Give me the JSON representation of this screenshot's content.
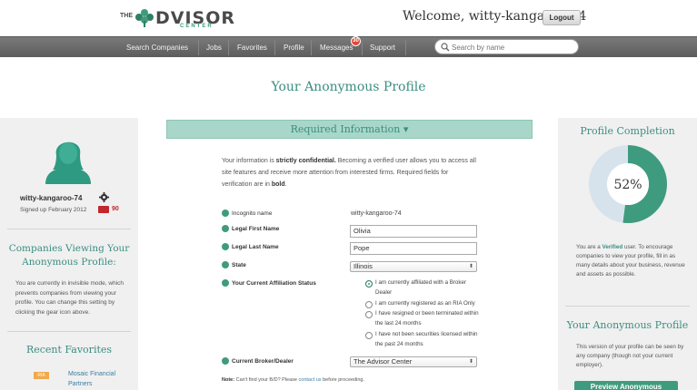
{
  "logo": {
    "prefix": "THE",
    "word": "DVISOR",
    "sub": "CENTER"
  },
  "header": {
    "welcome": "Welcome, witty-kangaroo-74",
    "logout_label": "Logout"
  },
  "nav": {
    "items": [
      "Search Companies",
      "Jobs",
      "Favorites",
      "Profile",
      "Messages",
      "Support"
    ],
    "messages_badge": "30"
  },
  "search": {
    "placeholder": "Search by name"
  },
  "page_title": "Your Anonymous Profile",
  "left": {
    "username": "witty-kangaroo-74",
    "signup": "Signed up February 2012",
    "score": "90",
    "companies_title": "Companies Viewing Your Anonymous Profile:",
    "companies_text": "You are currently in invisible mode, which prevents companies from viewing your profile. You can change this setting by clicking the gear icon above.",
    "favorites_title": "Recent Favorites",
    "favorite_tag": "RIA",
    "favorite_name": "Mosaic Financial Partners"
  },
  "main": {
    "section_title": "Required Information ▾",
    "intro_pre": "Your information is ",
    "intro_strong": "strictly confidential.",
    "intro_mid": " Becoming a verified user allows you to access all site features and receive more attention from interested firms. Required fields for verification are in ",
    "intro_bold": "bold",
    "intro_end": ".",
    "incognito_label": "Incognito name",
    "incognito_value": "witty-kangaroo-74",
    "first_name_label": "Legal First Name",
    "first_name_value": "Olivia",
    "last_name_label": "Legal Last Name",
    "last_name_value": "Pope",
    "state_label": "State",
    "state_value": "Illinois",
    "affiliation_label": "Your Current Affiliation Status",
    "affiliation_options": [
      "I am currently affiliated with a Broker Dealer",
      "I am currently registered as an RIA Only",
      "I have resigned or been terminated within the last 24 months",
      "I have not been securities licensed within the past 24 months"
    ],
    "affiliation_selected": 0,
    "bd_label": "Current Broker/Dealer",
    "bd_value": "The Advisor Center",
    "note_label": "Note:",
    "note_text": " Can't find your B/D? Please ",
    "note_link": "contact us",
    "note_end": " before proceeding."
  },
  "right": {
    "completion_title": "Profile Completion",
    "completion_pct": "52%",
    "completion_value": 0.52,
    "verified_pre": "You are a ",
    "verified_word": "Verified",
    "verified_text": " user. To encourage companies to view your profile, fill in as many details about your business, revenue and assets as possible.",
    "anon_title": "Your Anonymous Profile",
    "anon_text": "This version of your profile can be seen by any company (though not your current employer).",
    "preview_label": "Preview Anonymous"
  },
  "colors": {
    "accent": "#3f9b7e",
    "accent_light": "#a8d7c9",
    "donut_bg": "#d6e3ec",
    "nav_bg": "#6b6b6b"
  }
}
